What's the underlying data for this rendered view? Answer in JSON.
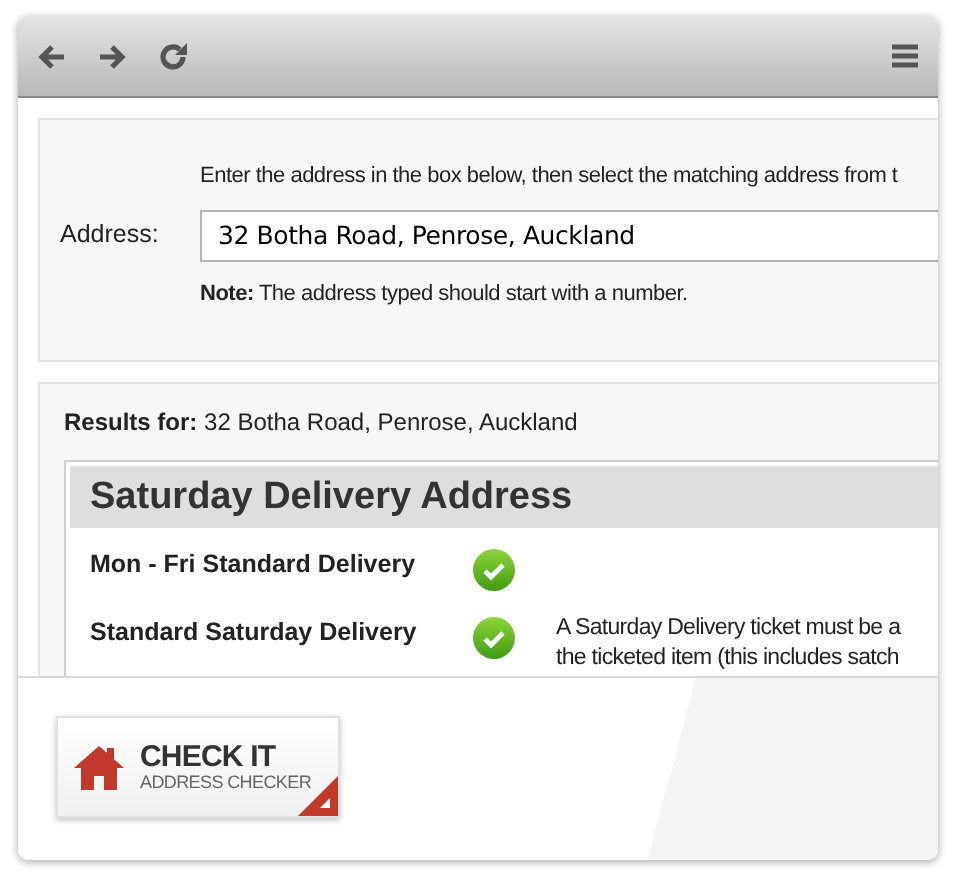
{
  "form": {
    "instruction": "Enter the address in the box below, then select the matching address from t",
    "address_label": "Address:",
    "address_value": "32 Botha Road, Penrose, Auckland",
    "note": "**Note:** The address typed should start with a number."
  },
  "results": {
    "label": "Results for:",
    "query": "32 Botha Road, Penrose, Auckland",
    "table": {
      "title": "Saturday Delivery Address",
      "rows": [
        {
          "service": "Mon - Fri Standard Delivery",
          "available": true
        },
        {
          "service": "Standard Saturday Delivery",
          "available": true,
          "details": [
            "A Saturday Delivery ticket must be a",
            "the ticketed item (this includes satch"
          ]
        }
      ]
    }
  },
  "badge": {
    "title": "CHECK IT",
    "subtitle": "ADDRESS CHECKER"
  }
}
